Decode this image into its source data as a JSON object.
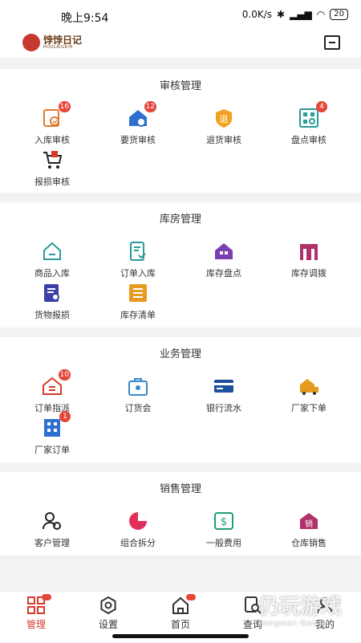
{
  "status": {
    "time": "晚上9:54",
    "speed": "0.0K/s",
    "battery": "20"
  },
  "app": {
    "logo_text": "饽饽日记",
    "logo_sub": "HUOLAIGRIH"
  },
  "colors": {
    "accent": "#d63a2c",
    "badge": "#e5463a"
  },
  "sections": [
    {
      "title": "审核管理",
      "items": [
        {
          "label": "入库审核",
          "badge": "16",
          "icon": "inbound-review-icon"
        },
        {
          "label": "要货审核",
          "badge": "12",
          "icon": "request-review-icon"
        },
        {
          "label": "退货审核",
          "badge": "",
          "icon": "return-review-icon",
          "glyph": "退"
        },
        {
          "label": "盘点审核",
          "badge": "4",
          "icon": "inventory-review-icon"
        },
        {
          "label": "报损审核",
          "badge": "",
          "icon": "damage-review-icon"
        }
      ]
    },
    {
      "title": "库房管理",
      "items": [
        {
          "label": "商品入库",
          "badge": "",
          "icon": "goods-inbound-icon"
        },
        {
          "label": "订单入库",
          "badge": "",
          "icon": "order-inbound-icon"
        },
        {
          "label": "库存盘点",
          "badge": "",
          "icon": "stock-count-icon"
        },
        {
          "label": "库存调拨",
          "badge": "",
          "icon": "stock-transfer-icon"
        },
        {
          "label": "货物报损",
          "badge": "",
          "icon": "goods-damage-icon"
        },
        {
          "label": "库存清单",
          "badge": "",
          "icon": "stock-list-icon"
        }
      ]
    },
    {
      "title": "业务管理",
      "items": [
        {
          "label": "订单指派",
          "badge": "10",
          "icon": "order-assign-icon"
        },
        {
          "label": "订货会",
          "badge": "",
          "icon": "order-fair-icon"
        },
        {
          "label": "银行流水",
          "badge": "",
          "icon": "bank-statement-icon"
        },
        {
          "label": "厂家下单",
          "badge": "",
          "icon": "factory-order-icon"
        },
        {
          "label": "厂家订单",
          "badge": "1",
          "icon": "factory-orders-icon"
        }
      ]
    },
    {
      "title": "销售管理",
      "items": [
        {
          "label": "客户管理",
          "badge": "",
          "icon": "customer-icon"
        },
        {
          "label": "组合拆分",
          "badge": "",
          "icon": "combo-split-icon"
        },
        {
          "label": "一般费用",
          "badge": "",
          "icon": "expense-icon"
        },
        {
          "label": "仓库销售",
          "badge": "",
          "icon": "warehouse-sales-icon",
          "glyph": "销"
        }
      ]
    }
  ],
  "tabs": [
    {
      "label": "管理",
      "active": true
    },
    {
      "label": "设置",
      "active": false
    },
    {
      "label": "首页",
      "active": false
    },
    {
      "label": "查询",
      "active": false
    },
    {
      "label": "我的",
      "active": false
    }
  ],
  "watermark": {
    "main": "仍玩游戏",
    "sub": "Rengwan Games"
  }
}
